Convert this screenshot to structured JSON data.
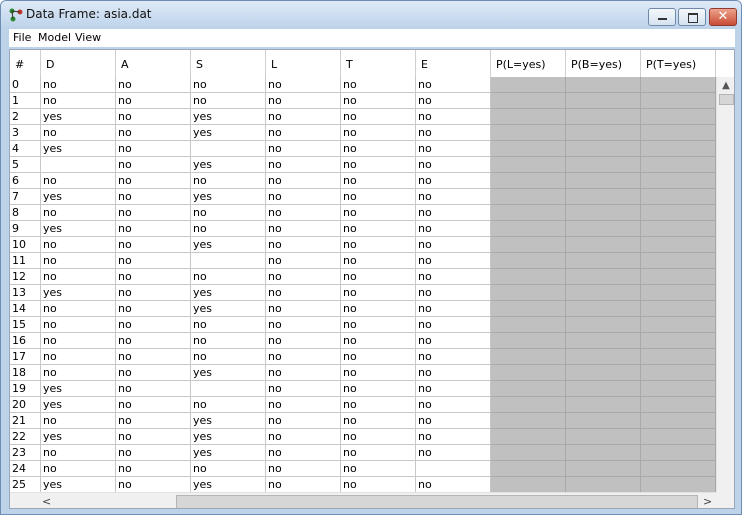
{
  "window": {
    "title": "Data Frame: asia.dat"
  },
  "menu": {
    "file": "File",
    "model": "Model",
    "view": "View"
  },
  "columns": [
    "#",
    "D",
    "A",
    "S",
    "L",
    "T",
    "E",
    "P(L=yes)",
    "P(B=yes)",
    "P(T=yes)"
  ],
  "rows": [
    [
      "0",
      "no",
      "no",
      "no",
      "no",
      "no",
      "no"
    ],
    [
      "1",
      "no",
      "no",
      "no",
      "no",
      "no",
      "no"
    ],
    [
      "2",
      "yes",
      "no",
      "yes",
      "no",
      "no",
      "no"
    ],
    [
      "3",
      "no",
      "no",
      "yes",
      "no",
      "no",
      "no"
    ],
    [
      "4",
      "yes",
      "no",
      "",
      "no",
      "no",
      "no"
    ],
    [
      "5",
      "",
      "no",
      "yes",
      "no",
      "no",
      "no"
    ],
    [
      "6",
      "no",
      "no",
      "no",
      "no",
      "no",
      "no"
    ],
    [
      "7",
      "yes",
      "no",
      "yes",
      "no",
      "no",
      "no"
    ],
    [
      "8",
      "no",
      "no",
      "no",
      "no",
      "no",
      "no"
    ],
    [
      "9",
      "yes",
      "no",
      "no",
      "no",
      "no",
      "no"
    ],
    [
      "10",
      "no",
      "no",
      "yes",
      "no",
      "no",
      "no"
    ],
    [
      "11",
      "no",
      "no",
      "",
      "no",
      "no",
      "no"
    ],
    [
      "12",
      "no",
      "no",
      "no",
      "no",
      "no",
      "no"
    ],
    [
      "13",
      "yes",
      "no",
      "yes",
      "no",
      "no",
      "no"
    ],
    [
      "14",
      "no",
      "no",
      "yes",
      "no",
      "no",
      "no"
    ],
    [
      "15",
      "no",
      "no",
      "no",
      "no",
      "no",
      "no"
    ],
    [
      "16",
      "no",
      "no",
      "no",
      "no",
      "no",
      "no"
    ],
    [
      "17",
      "no",
      "no",
      "no",
      "no",
      "no",
      "no"
    ],
    [
      "18",
      "no",
      "no",
      "yes",
      "no",
      "no",
      "no"
    ],
    [
      "19",
      "yes",
      "no",
      "",
      "no",
      "no",
      "no"
    ],
    [
      "20",
      "yes",
      "no",
      "no",
      "no",
      "no",
      "no"
    ],
    [
      "21",
      "no",
      "no",
      "yes",
      "no",
      "no",
      "no"
    ],
    [
      "22",
      "yes",
      "no",
      "yes",
      "no",
      "no",
      "no"
    ],
    [
      "23",
      "no",
      "no",
      "yes",
      "no",
      "no",
      "no"
    ],
    [
      "24",
      "no",
      "no",
      "no",
      "no",
      "no",
      ""
    ],
    [
      "25",
      "yes",
      "no",
      "yes",
      "no",
      "no",
      "no"
    ]
  ],
  "colors": {
    "title_bar": "#bcd2ea",
    "probability_fill": "#c0c0c0",
    "close_button": "#c94b34"
  },
  "icons": {
    "app": "bayes-net-icon",
    "minimize": "minimize-icon",
    "maximize": "maximize-icon",
    "close": "close-icon"
  }
}
